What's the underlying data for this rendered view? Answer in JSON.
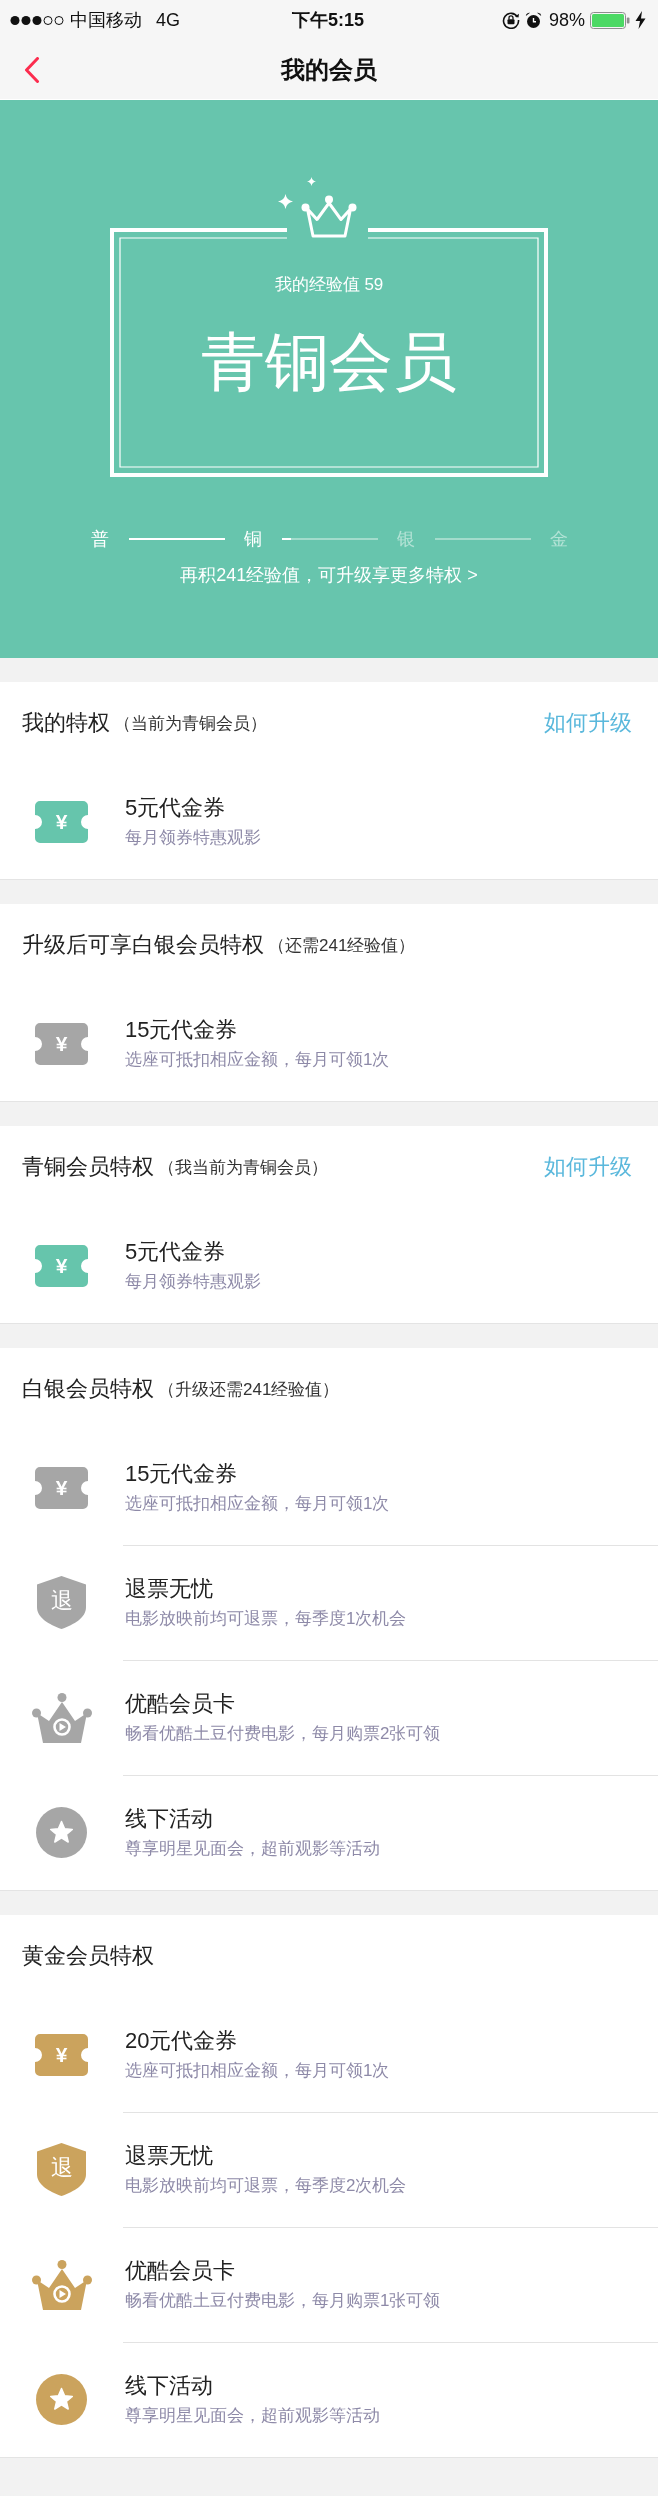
{
  "status_bar": {
    "carrier": "中国移动",
    "network": "4G",
    "time": "下午5:15",
    "battery": "98%"
  },
  "nav": {
    "title": "我的会员"
  },
  "hero": {
    "experience": "我的经验值 59",
    "level_name": "青铜会员",
    "tiers": [
      {
        "label": "普",
        "reached": true
      },
      {
        "label": "铜",
        "reached": true
      },
      {
        "label": "银",
        "reached": false
      },
      {
        "label": "金",
        "reached": false
      }
    ],
    "segments": [
      {
        "level": 1
      },
      {
        "level": 0.1
      },
      {
        "level": 0
      }
    ],
    "hint": "再积241经验值，可升级享更多特权 >"
  },
  "sections": [
    {
      "title": "我的特权",
      "note": "（当前为青铜会员）",
      "link": "如何升级",
      "color": "#66c5ac",
      "items": [
        {
          "kind": "voucher",
          "badge": "¥",
          "title": "5元代金券",
          "desc": "每月领券特惠观影"
        }
      ]
    },
    {
      "title": "升级后可享白银会员特权",
      "note": "（还需241经验值）",
      "color": "#a6a6a6",
      "items": [
        {
          "kind": "voucher",
          "badge": "¥",
          "title": "15元代金券",
          "desc": "选座可抵扣相应金额，每月可领1次"
        }
      ]
    },
    {
      "title": "青铜会员特权",
      "note": "（我当前为青铜会员）",
      "link": "如何升级",
      "color": "#66c5ac",
      "items": [
        {
          "kind": "voucher",
          "badge": "¥",
          "title": "5元代金券",
          "desc": "每月领券特惠观影"
        }
      ]
    },
    {
      "title": "白银会员特权",
      "note": "（升级还需241经验值）",
      "color": "#a6a6a6",
      "items": [
        {
          "kind": "voucher",
          "badge": "¥",
          "title": "15元代金券",
          "desc": "选座可抵扣相应金额，每月可领1次"
        },
        {
          "kind": "refund",
          "badge": "退",
          "title": "退票无忧",
          "desc": "电影放映前均可退票，每季度1次机会"
        },
        {
          "kind": "video",
          "title": "优酷会员卡",
          "desc": "畅看优酷土豆付费电影，每月购票2张可领"
        },
        {
          "kind": "event",
          "title": "线下活动",
          "desc": "尊享明星见面会，超前观影等活动"
        }
      ]
    },
    {
      "title": "黄金会员特权",
      "color": "#cba35d",
      "items": [
        {
          "kind": "voucher",
          "badge": "¥",
          "title": "20元代金券",
          "desc": "选座可抵扣相应金额，每月可领1次"
        },
        {
          "kind": "refund",
          "badge": "退",
          "title": "退票无忧",
          "desc": "电影放映前均可退票，每季度2次机会"
        },
        {
          "kind": "video",
          "title": "优酷会员卡",
          "desc": "畅看优酷土豆付费电影，每月购票1张可领"
        },
        {
          "kind": "event",
          "title": "线下活动",
          "desc": "尊享明星见面会，超前观影等活动"
        }
      ]
    }
  ]
}
